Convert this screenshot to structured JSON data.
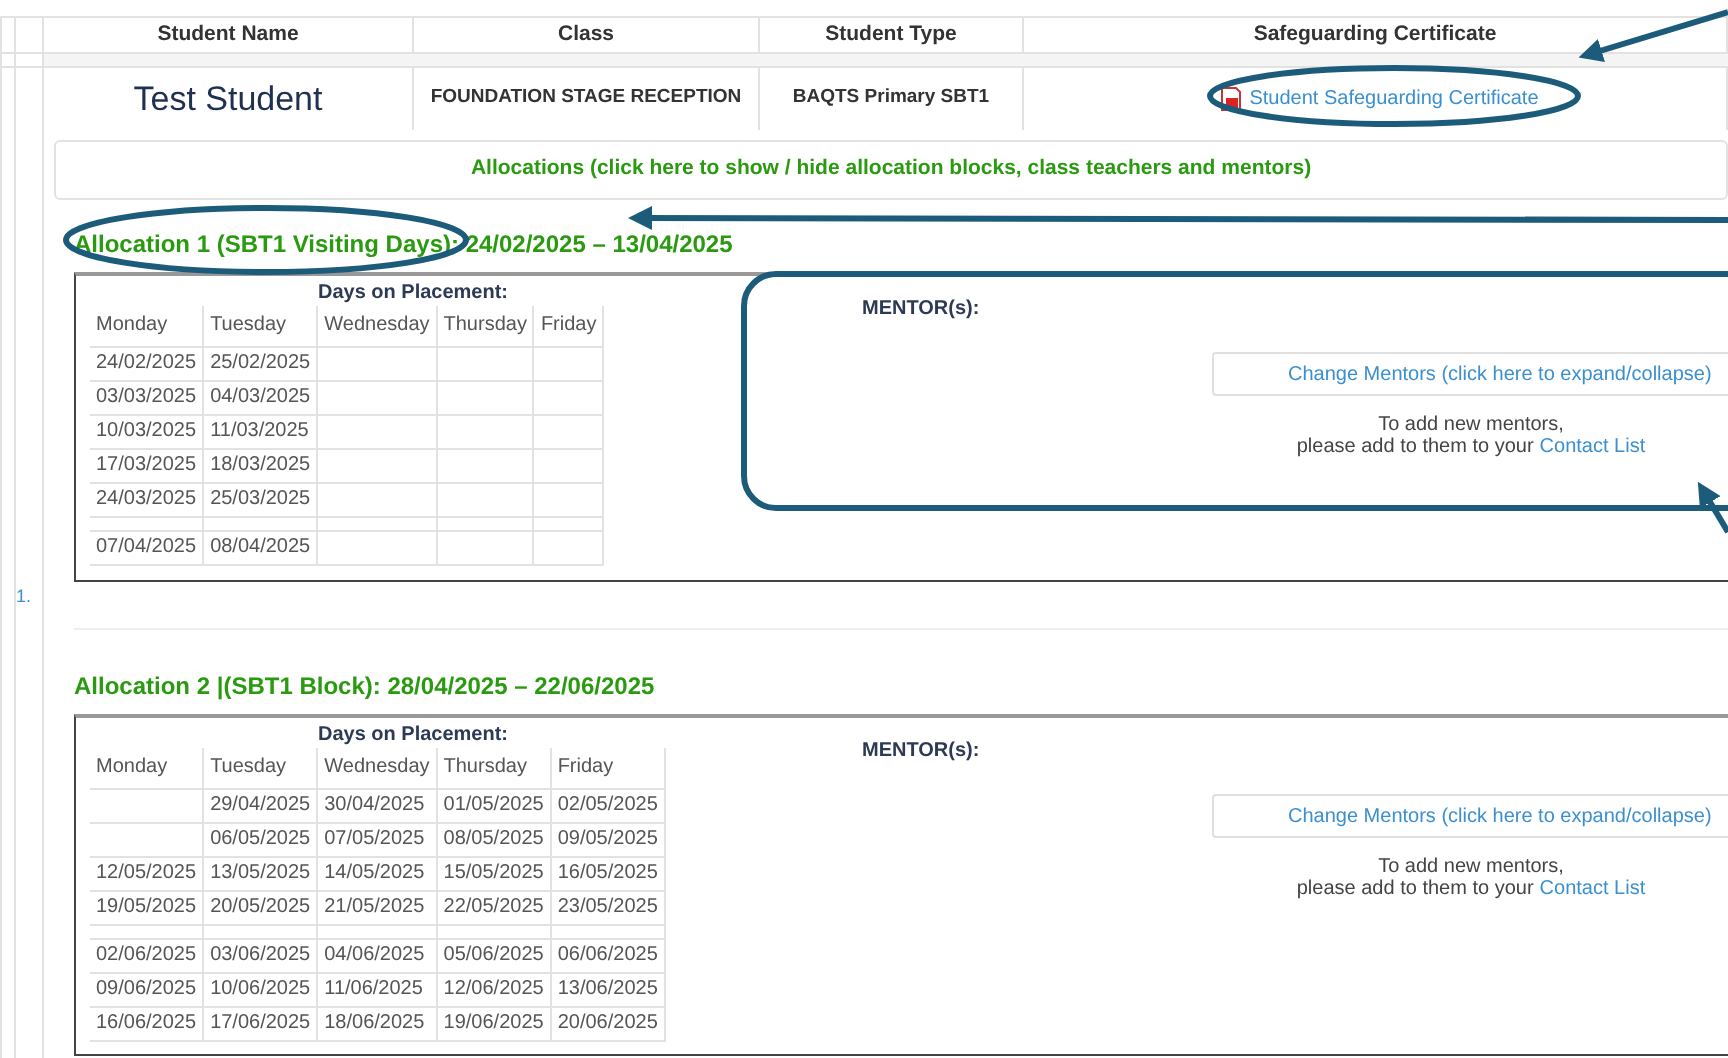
{
  "table": {
    "columns": [
      "Student Name",
      "Class",
      "Student Type",
      "Safeguarding Certificate"
    ],
    "row": {
      "student_name": "Test Student",
      "class": "FOUNDATION STAGE RECEPTION",
      "student_type": "BAQTS Primary SBT1",
      "certificate_link": "Student Safeguarding Certificate"
    }
  },
  "allocations_toggle": "Allocations (click here to show / hide allocation blocks, class teachers and mentors)",
  "list_number": "1.",
  "allocations": [
    {
      "title": "Allocation 1 (SBT1 Visiting Days): 24/02/2025 – 13/04/2025",
      "days_heading": "Days on Placement:",
      "days": [
        "Monday",
        "Tuesday",
        "Wednesday",
        "Thursday",
        "Friday"
      ],
      "rows": [
        {
          "kind": "dates",
          "mon": "24/02/2025",
          "tue": "25/02/2025"
        },
        {
          "kind": "dates",
          "mon": "03/03/2025",
          "tue": "04/03/2025"
        },
        {
          "kind": "dates",
          "mon": "10/03/2025",
          "tue": "11/03/2025"
        },
        {
          "kind": "dates",
          "mon": "17/03/2025",
          "tue": "18/03/2025"
        },
        {
          "kind": "dates",
          "mon": "24/03/2025",
          "tue": "25/03/2025"
        },
        {
          "kind": "spacer"
        },
        {
          "kind": "dates",
          "mon": "07/04/2025",
          "tue": "08/04/2025"
        }
      ],
      "mentors_label": "MENTOR(s):",
      "change_mentors": "Change Mentors (click here to expand/collapse)",
      "note": "To add new mentors,",
      "note_2": "please add to them to your",
      "contact_link": "Contact List"
    },
    {
      "title": "Allocation 2 |(SBT1 Block): 28/04/2025 – 22/06/2025",
      "days_heading": "Days on Placement:",
      "days": [
        "Monday",
        "Tuesday",
        "Wednesday",
        "Thursday",
        "Friday"
      ],
      "rows": [
        {
          "kind": "dates",
          "tue": "29/04/2025",
          "wed": "30/04/2025",
          "thu": "01/05/2025",
          "fri": "02/05/2025"
        },
        {
          "kind": "dates",
          "tue": "06/05/2025",
          "wed": "07/05/2025",
          "thu": "08/05/2025",
          "fri": "09/05/2025"
        },
        {
          "kind": "dates",
          "mon": "12/05/2025",
          "tue": "13/05/2025",
          "wed": "14/05/2025",
          "thu": "15/05/2025",
          "fri": "16/05/2025"
        },
        {
          "kind": "dates",
          "mon": "19/05/2025",
          "tue": "20/05/2025",
          "wed": "21/05/2025",
          "thu": "22/05/2025",
          "fri": "23/05/2025"
        },
        {
          "kind": "spacer"
        },
        {
          "kind": "dates",
          "mon": "02/06/2025",
          "tue": "03/06/2025",
          "wed": "04/06/2025",
          "thu": "05/06/2025",
          "fri": "06/06/2025"
        },
        {
          "kind": "dates",
          "mon": "09/06/2025",
          "tue": "10/06/2025",
          "wed": "11/06/2025",
          "thu": "12/06/2025",
          "fri": "13/06/2025"
        },
        {
          "kind": "dates",
          "mon": "16/06/2025",
          "tue": "17/06/2025",
          "wed": "18/06/2025",
          "thu": "19/06/2025",
          "fri": "20/06/2025"
        }
      ],
      "mentors_label": "MENTOR(s):",
      "change_mentors": "Change Mentors (click here to expand/collapse)",
      "note": "To add new mentors,",
      "note_2": "please add to them to your",
      "contact_link": "Contact List"
    }
  ]
}
